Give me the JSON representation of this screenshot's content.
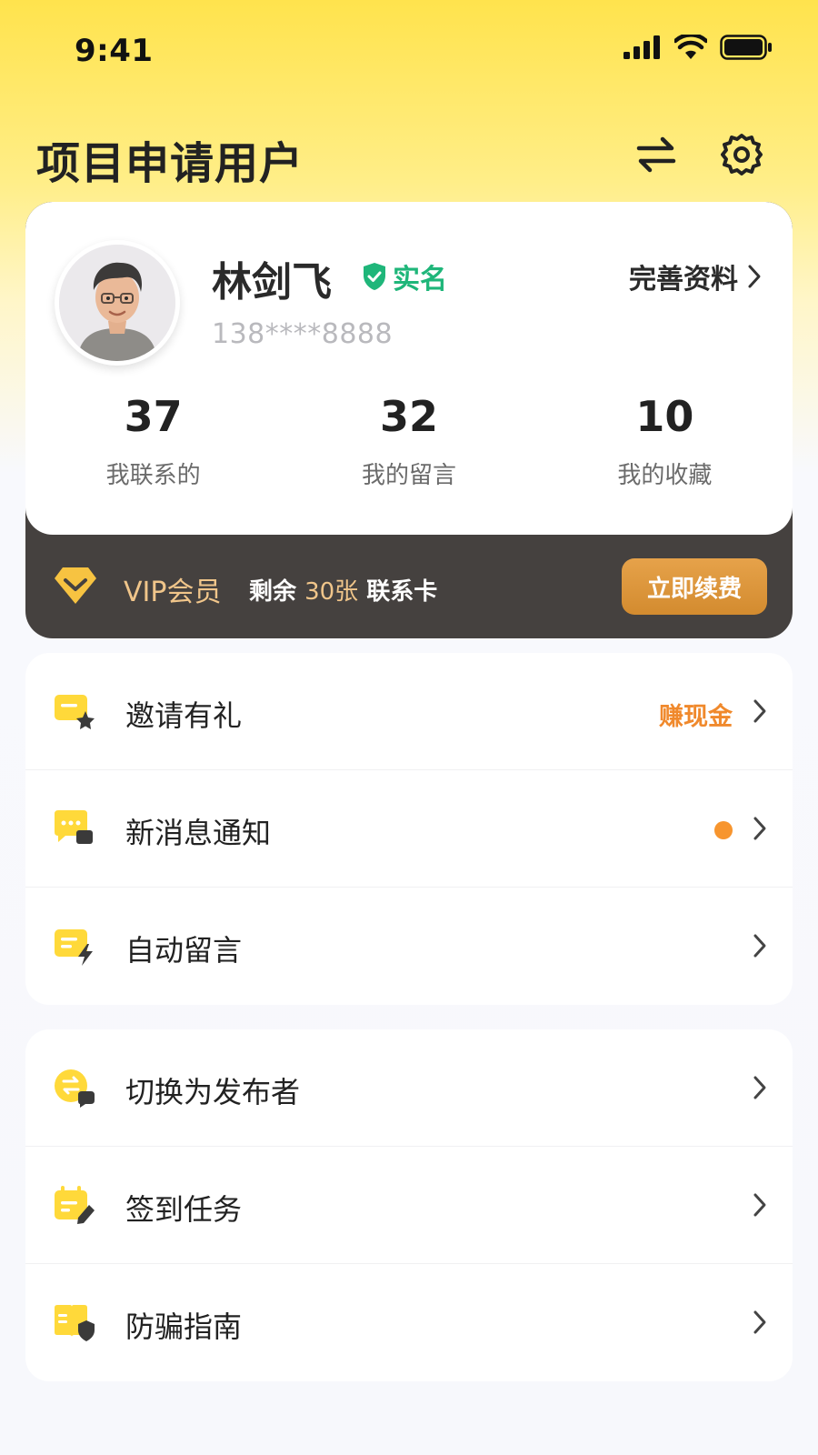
{
  "status_bar": {
    "time": "9:41"
  },
  "header": {
    "title": "项目申请用户"
  },
  "profile": {
    "name": "林剑飞",
    "verified_label": "实名",
    "phone": "138****8888",
    "edit_label": "完善资料",
    "stats": [
      {
        "value": "37",
        "label": "我联系的"
      },
      {
        "value": "32",
        "label": "我的留言"
      },
      {
        "value": "10",
        "label": "我的收藏"
      }
    ]
  },
  "vip": {
    "title": "VIP会员",
    "remaining_prefix": "剩余",
    "remaining_count": "30张",
    "remaining_suffix": "联系卡",
    "renew_label": "立即续费"
  },
  "menu_group_1": [
    {
      "label": "邀请有礼",
      "extra": "赚现金",
      "icon": "gift-card-icon"
    },
    {
      "label": "新消息通知",
      "badge": "dot",
      "icon": "message-icon"
    },
    {
      "label": "自动留言",
      "icon": "auto-reply-icon"
    }
  ],
  "menu_group_2": [
    {
      "label": "切换为发布者",
      "icon": "switch-role-icon"
    },
    {
      "label": "签到任务",
      "icon": "calendar-icon"
    },
    {
      "label": "防骗指南",
      "icon": "shield-guide-icon"
    }
  ],
  "colors": {
    "accent_yellow": "#ffd93a",
    "verified_green": "#1fb67a",
    "vip_dark": "#45413f",
    "vip_gold": "#f0c58a",
    "orange": "#f0892c"
  }
}
